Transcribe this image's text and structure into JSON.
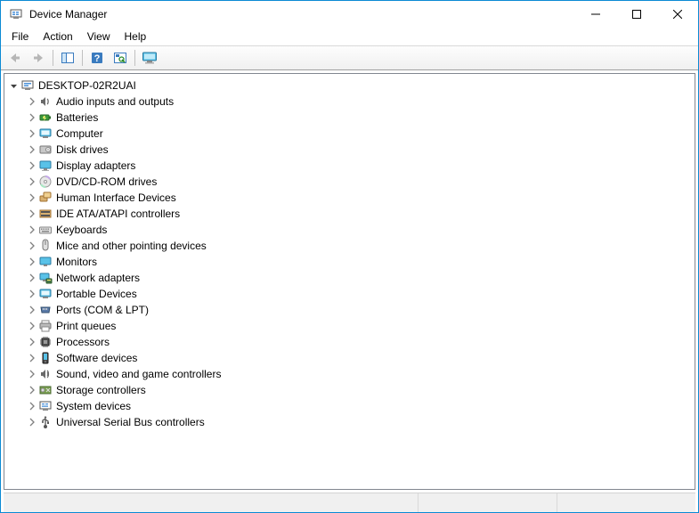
{
  "window": {
    "title": "Device Manager"
  },
  "menu": {
    "file": "File",
    "action": "Action",
    "view": "View",
    "help": "Help"
  },
  "tree": {
    "root": {
      "label": "DESKTOP-02R2UAI",
      "expanded": true
    },
    "items": [
      {
        "label": "Audio inputs and outputs",
        "icon": "audio"
      },
      {
        "label": "Batteries",
        "icon": "battery"
      },
      {
        "label": "Computer",
        "icon": "computer"
      },
      {
        "label": "Disk drives",
        "icon": "disk"
      },
      {
        "label": "Display adapters",
        "icon": "display"
      },
      {
        "label": "DVD/CD-ROM drives",
        "icon": "dvd"
      },
      {
        "label": "Human Interface Devices",
        "icon": "hid"
      },
      {
        "label": "IDE ATA/ATAPI controllers",
        "icon": "ide"
      },
      {
        "label": "Keyboards",
        "icon": "keyboard"
      },
      {
        "label": "Mice and other pointing devices",
        "icon": "mouse"
      },
      {
        "label": "Monitors",
        "icon": "monitor"
      },
      {
        "label": "Network adapters",
        "icon": "network"
      },
      {
        "label": "Portable Devices",
        "icon": "portable"
      },
      {
        "label": "Ports (COM & LPT)",
        "icon": "port"
      },
      {
        "label": "Print queues",
        "icon": "printer"
      },
      {
        "label": "Processors",
        "icon": "cpu"
      },
      {
        "label": "Software devices",
        "icon": "software"
      },
      {
        "label": "Sound, video and game controllers",
        "icon": "sound"
      },
      {
        "label": "Storage controllers",
        "icon": "storage"
      },
      {
        "label": "System devices",
        "icon": "system"
      },
      {
        "label": "Universal Serial Bus controllers",
        "icon": "usb"
      }
    ]
  }
}
